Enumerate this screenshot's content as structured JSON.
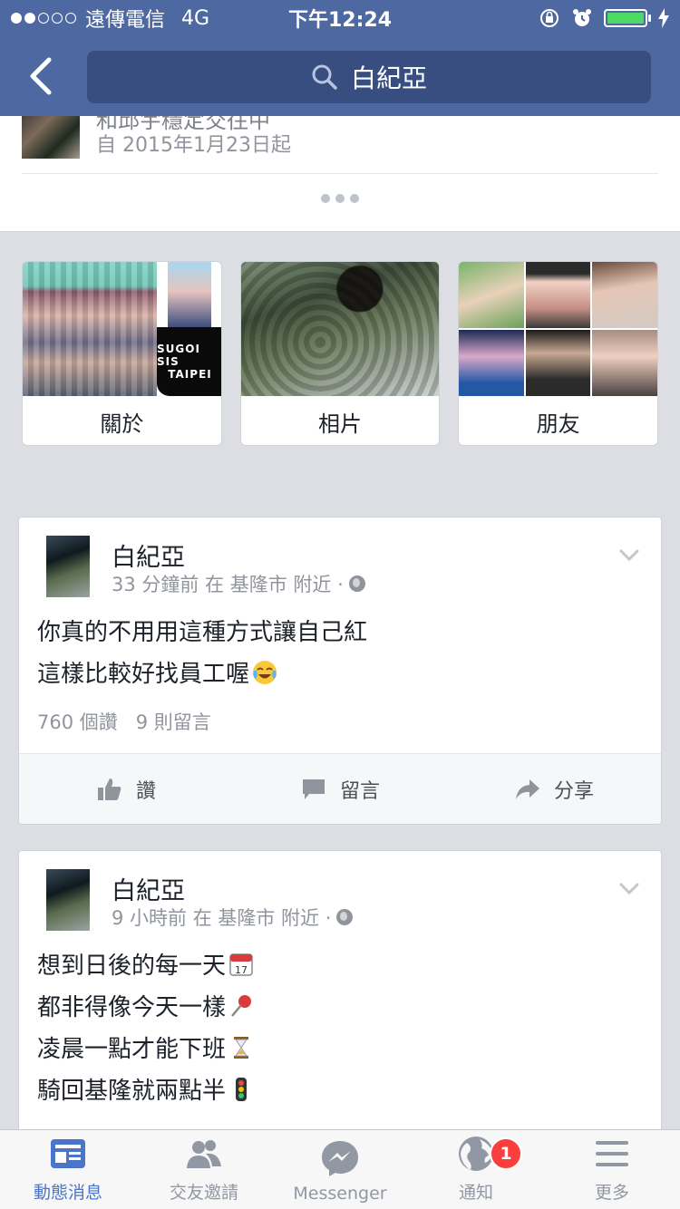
{
  "status_bar": {
    "carrier": "遠傳電信",
    "network": "4G",
    "time": "下午12:24"
  },
  "nav": {
    "search_text": "白紀亞"
  },
  "relationship": {
    "cut_line": "和邱宇穩定交往中",
    "since": "自 2015年1月23日起"
  },
  "tiles": [
    {
      "label": "關於"
    },
    {
      "label": "相片"
    },
    {
      "label": "朋友"
    }
  ],
  "about_overlay": {
    "line1": "SUGOI SIS",
    "line2": "TAIPEI"
  },
  "posts": [
    {
      "author": "白紀亞",
      "meta": "33 分鐘前 在 基隆市 附近 ·",
      "lines": [
        "你真的不用用這種方式讓自己紅",
        "這樣比較好找員工喔"
      ],
      "likes": "760 個讚",
      "comments": "9 則留言"
    },
    {
      "author": "白紀亞",
      "meta": "9 小時前 在 基隆市 附近 ·",
      "lines": [
        "想到日後的每一天",
        "都非得像今天一樣",
        "凌晨一點才能下班",
        "騎回基隆就兩點半"
      ]
    }
  ],
  "actions": {
    "like": "讚",
    "comment": "留言",
    "share": "分享"
  },
  "tabbar": {
    "items": [
      {
        "label": "動態消息",
        "icon": "news-feed-icon"
      },
      {
        "label": "交友邀請",
        "icon": "friend-requests-icon"
      },
      {
        "label": "Messenger",
        "icon": "messenger-icon"
      },
      {
        "label": "通知",
        "icon": "globe-notifications-icon"
      },
      {
        "label": "更多",
        "icon": "hamburger-menu-icon"
      }
    ],
    "notification_count": "1"
  },
  "colors": {
    "brand": "#4e69a2",
    "active_tab": "#4b75c9",
    "badge": "#fa3e3e"
  }
}
